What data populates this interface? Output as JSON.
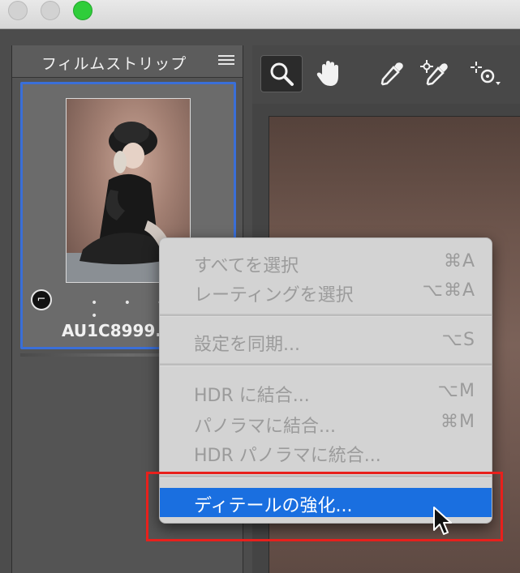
{
  "window": {
    "traffic_lights": [
      "close",
      "minimize",
      "zoom"
    ]
  },
  "filmstrip": {
    "title": "フィルムストリップ",
    "menu_icon": "hamburger-icon",
    "thumbnail": {
      "filename": "AU1C8999.",
      "rating_dots": "• • • • •",
      "crop_badge_icon": "crop-icon"
    }
  },
  "toolbar": {
    "tools": [
      {
        "name": "zoom-tool",
        "icon": "magnifier-icon",
        "active": true
      },
      {
        "name": "hand-tool",
        "icon": "hand-icon",
        "active": false
      },
      {
        "name": "white-balance-tool",
        "icon": "eyedropper-icon",
        "active": false
      },
      {
        "name": "color-sampler-tool",
        "icon": "color-sampler-icon",
        "active": false
      },
      {
        "name": "targeted-adjustment-tool",
        "icon": "targeted-adjustment-icon",
        "active": false
      }
    ]
  },
  "context_menu": {
    "items": [
      {
        "label": "すべてを選択",
        "shortcut": "⌘A",
        "enabled": false
      },
      {
        "label": "レーティングを選択",
        "shortcut": "⌥⌘A",
        "enabled": false
      },
      {
        "label": "設定を同期...",
        "shortcut": "⌥S",
        "enabled": false
      },
      {
        "label": "HDR に結合...",
        "shortcut": "⌥M",
        "enabled": false
      },
      {
        "label": "パノラマに結合...",
        "shortcut": "⌘M",
        "enabled": false
      },
      {
        "label": "HDR パノラマに統合...",
        "shortcut": "",
        "enabled": false
      },
      {
        "label": "ディテールの強化...",
        "shortcut": "",
        "enabled": true,
        "highlighted": true
      }
    ]
  },
  "colors": {
    "highlight": "#1a6fe0",
    "annotation": "#e8201c",
    "selection_border": "#3a6fd8"
  }
}
